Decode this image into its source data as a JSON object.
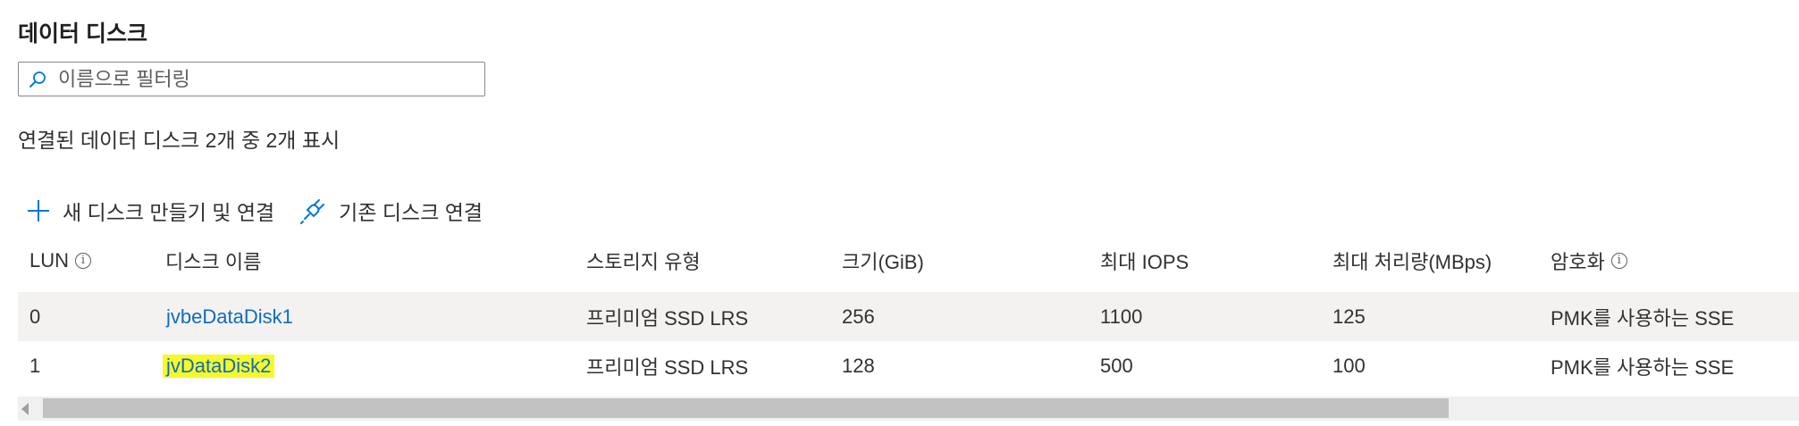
{
  "section": {
    "title": "데이터 디스크"
  },
  "filter": {
    "placeholder": "이름으로 필터링"
  },
  "summary": "연결된 데이터 디스크 2개 중 2개 표시",
  "toolbar": {
    "create_attach_label": "새 디스크 만들기 및 연결",
    "attach_existing_label": "기존 디스크 연결",
    "create_icon": "plus-icon",
    "attach_icon": "plug-icon"
  },
  "table": {
    "headers": {
      "lun": "LUN",
      "disk_name": "디스크 이름",
      "storage_type": "스토리지 유형",
      "size": "크기(GiB)",
      "max_iops": "최대 IOPS",
      "max_throughput": "최대 처리량(MBps)",
      "encryption": "암호화"
    },
    "rows": [
      {
        "lun": "0",
        "disk_name": "jvbeDataDisk1",
        "storage_type": "프리미엄 SSD LRS",
        "size": "256",
        "max_iops": "1100",
        "max_throughput": "125",
        "encryption": "PMK를 사용하는 SSE"
      },
      {
        "lun": "1",
        "disk_name": "jvDataDisk2",
        "storage_type": "프리미엄 SSD LRS",
        "size": "128",
        "max_iops": "500",
        "max_throughput": "100",
        "encryption": "PMK를 사용하는 SSE"
      }
    ]
  },
  "colors": {
    "link": "#0f6cbd",
    "highlight": "#f5f92a",
    "row_shade": "#f3f2f1",
    "icon_blue": "#0078d4"
  }
}
